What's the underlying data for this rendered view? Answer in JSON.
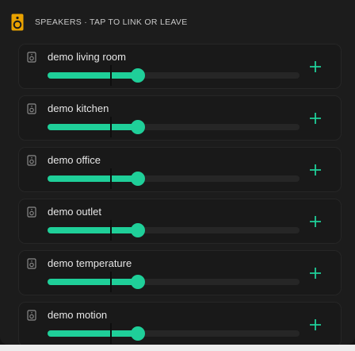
{
  "header": {
    "title": "SPEAKERS · TAP TO LINK OR LEAVE",
    "icon": "speaker-icon"
  },
  "colors": {
    "accent": "#1fcf99",
    "background": "#1c1c1c",
    "row_background": "#191919",
    "track": "#262626",
    "text": "#e6e6e6",
    "muted": "#8a8a8a"
  },
  "speakers": [
    {
      "name": "demo living room",
      "volume": 0.36,
      "icon": "speaker-icon",
      "action_icon": "plus-icon"
    },
    {
      "name": "demo kitchen",
      "volume": 0.36,
      "icon": "speaker-icon",
      "action_icon": "plus-icon"
    },
    {
      "name": "demo office",
      "volume": 0.36,
      "icon": "speaker-icon",
      "action_icon": "plus-icon"
    },
    {
      "name": "demo outlet",
      "volume": 0.36,
      "icon": "speaker-icon",
      "action_icon": "plus-icon"
    },
    {
      "name": "demo temperature",
      "volume": 0.36,
      "icon": "speaker-icon",
      "action_icon": "plus-icon"
    },
    {
      "name": "demo motion",
      "volume": 0.36,
      "icon": "speaker-icon",
      "action_icon": "plus-icon"
    }
  ]
}
